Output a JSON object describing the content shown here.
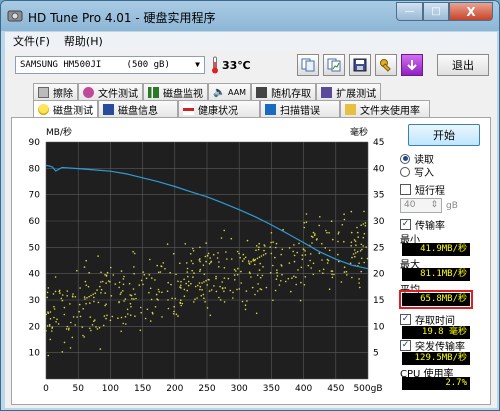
{
  "window": {
    "title": "HD Tune Pro 4.01 - 硬盘实用程序",
    "min": "—",
    "max": "□",
    "close": "X"
  },
  "menu": {
    "file": "文件(F)",
    "help": "帮助(H)"
  },
  "toolbar": {
    "drive_name": "SAMSUNG HM500JI",
    "drive_size": "(500 gB)",
    "temperature": "33℃",
    "exit_label": "退出"
  },
  "tabs": {
    "top": [
      "擦除",
      "文件测试",
      "磁盘监视",
      "AAM",
      "随机存取",
      "扩展测试"
    ],
    "bottom": [
      "磁盘测试",
      "磁盘信息",
      "健康状况",
      "扫描错误",
      "文件夹使用率"
    ]
  },
  "side": {
    "start_label": "开始",
    "read_label": "读取",
    "write_label": "写入",
    "short_stroke_label": "短行程",
    "short_stroke_value": "40",
    "short_stroke_unit": "gB",
    "transfer_label": "传输率",
    "min_label": "最小",
    "min_value": "41.9MB/秒",
    "max_label": "最大",
    "max_value": "81.1MB/秒",
    "avg_label": "平均",
    "avg_value": "65.8MB/秒",
    "access_label": "存取时间",
    "access_value": "19.8 毫秒",
    "burst_label": "突发传输率",
    "burst_value": "129.5MB/秒",
    "cpu_label": "CPU 使用率",
    "cpu_value": "2.7%"
  },
  "chart_data": {
    "type": "line",
    "left_axis_label": "MB/秒",
    "right_axis_label": "毫秒",
    "x_ticks": [
      "0",
      "50",
      "100",
      "150",
      "200",
      "250",
      "300",
      "350",
      "400",
      "450",
      "500gB"
    ],
    "y_left_ticks": [
      "90",
      "80",
      "70",
      "60",
      "50",
      "40",
      "30",
      "20",
      "10"
    ],
    "y_right_ticks": [
      "45",
      "40",
      "35",
      "30",
      "25",
      "20",
      "15",
      "10",
      "5"
    ],
    "xlim": [
      0,
      500
    ],
    "ylim_left": [
      0,
      90
    ],
    "ylim_right": [
      0,
      45
    ],
    "grid": true,
    "series": [
      {
        "color": "#2e9bd6",
        "axis": "left",
        "x": [
          0,
          5,
          10,
          15,
          25,
          50,
          75,
          100,
          125,
          150,
          175,
          200,
          225,
          250,
          275,
          300,
          325,
          350,
          375,
          400,
          425,
          450,
          475,
          500
        ],
        "values": [
          81.1,
          80.9,
          80.5,
          79.0,
          80.3,
          79.9,
          79.4,
          78.9,
          77.9,
          76.4,
          74.9,
          73.1,
          71.1,
          69.2,
          66.8,
          64.3,
          61.6,
          58.5,
          55.2,
          51.8,
          48.3,
          45.5,
          43.2,
          41.9
        ]
      },
      {
        "type": "scatter",
        "color": "#d8d84a",
        "axis": "right",
        "description_trend_start_ms": 13,
        "description_trend_end_ms": 26
      }
    ]
  },
  "colors": {
    "chart_bg": "#1f1f1f",
    "grid": "#5a5a5a",
    "transfer": "#2e9bd6",
    "access": "#d8d84a"
  }
}
